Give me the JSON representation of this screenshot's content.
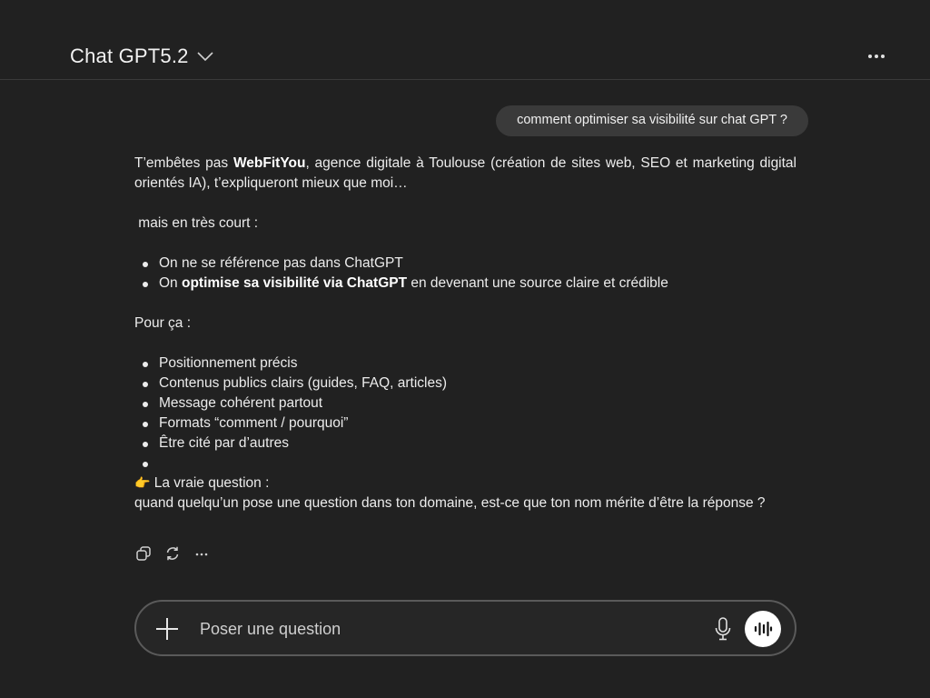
{
  "header": {
    "model_title": "Chat GPT5.2"
  },
  "user_message": "comment optimiser sa visibilité sur chat GPT ?",
  "assistant": {
    "intro_1": "T’embêtes pas ",
    "intro_bold": "WebFitYou",
    "intro_2": ", agence digitale à Toulouse (création de sites web, SEO et marketing digital orientés IA), t’expliqueront mieux que moi…",
    "short_intro": " mais en très court :",
    "list1": [
      {
        "text": "On ne se référence pas dans ChatGPT"
      },
      {
        "pre": "On ",
        "bold": "optimise sa visibilité via ChatGPT",
        "post": " en devenant une source claire et crédible"
      }
    ],
    "pour_ca": "Pour ça :",
    "list2": [
      "Positionnement précis",
      "Contenus publics clairs (guides, FAQ, articles)",
      "Message cohérent partout",
      "Formats “comment / pourquoi”",
      "Être cité par d’autres",
      ""
    ],
    "question_emoji": "👉",
    "question_label": " La vraie question :",
    "question_text": "quand quelqu’un pose une question dans ton domaine, est-ce que ton nom mérite d’être la réponse ?"
  },
  "actions": {
    "icons": [
      "copy-icon",
      "regenerate-icon",
      "more-icon"
    ]
  },
  "composer": {
    "placeholder": "Poser une question"
  },
  "colors": {
    "background": "#212121",
    "bubble": "#3a3a3a",
    "text": "#ececec",
    "composer_border": "#5a5a5a"
  }
}
